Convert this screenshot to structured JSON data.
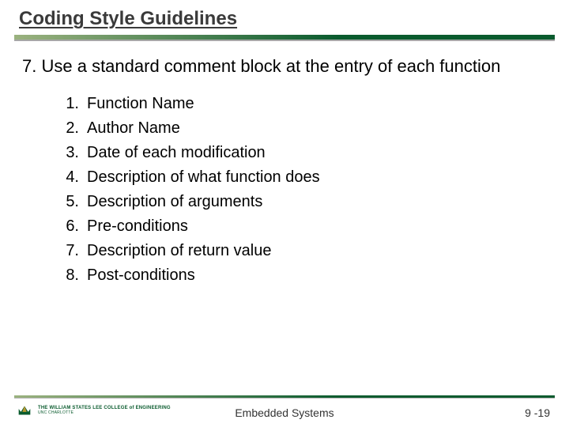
{
  "title": "Coding Style Guidelines",
  "heading": {
    "number": "7.",
    "text": "Use a standard comment block at the entry of each function"
  },
  "items": [
    {
      "num": "1.",
      "text": "Function Name"
    },
    {
      "num": "2.",
      "text": "Author Name"
    },
    {
      "num": "3.",
      "text": "Date of each modification"
    },
    {
      "num": "4.",
      "text": "Description of what function does"
    },
    {
      "num": "5.",
      "text": "Description of arguments"
    },
    {
      "num": "6.",
      "text": "Pre-conditions"
    },
    {
      "num": "7.",
      "text": "Description of return value"
    },
    {
      "num": "8.",
      "text": "Post-conditions"
    }
  ],
  "footer": {
    "logo": {
      "line1": "THE WILLIAM STATES LEE COLLEGE of ENGINEERING",
      "line2": "UNC CHARLOTTE"
    },
    "center": "Embedded Systems",
    "page": "9 -19"
  }
}
